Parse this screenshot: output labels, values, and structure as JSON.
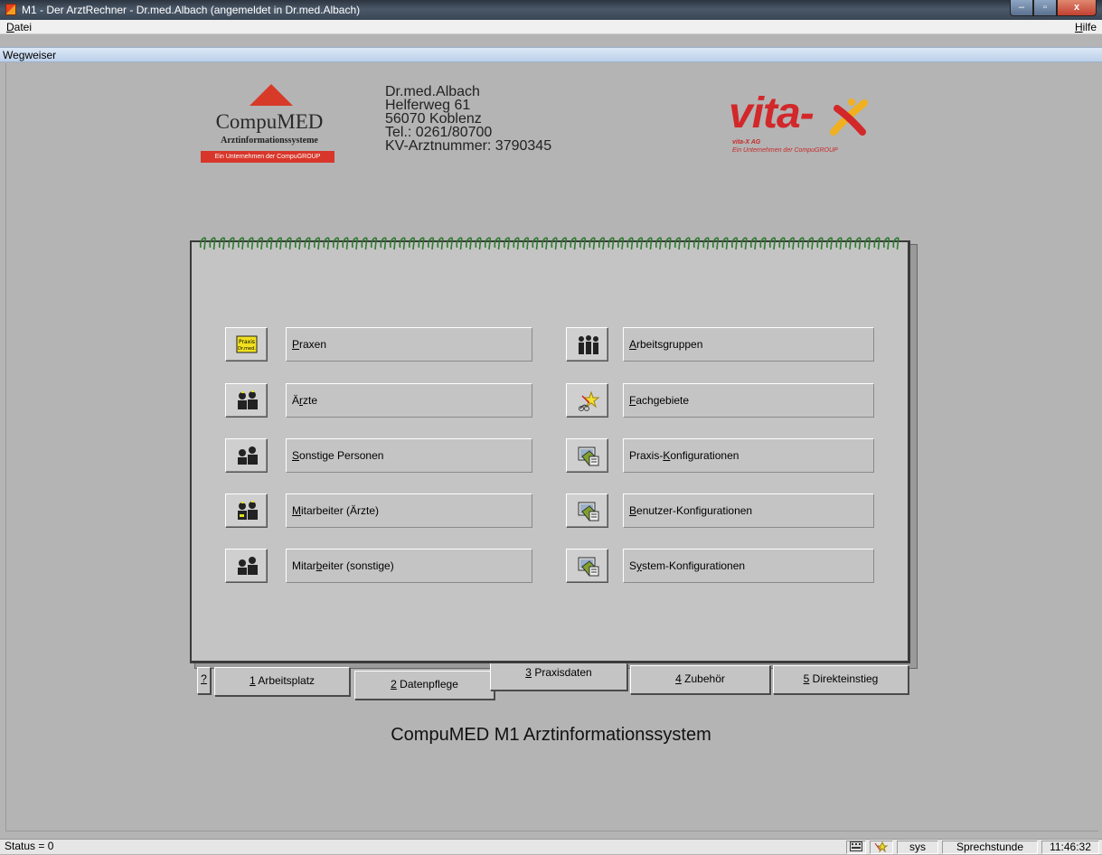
{
  "window": {
    "title": "M1 - Der ArztRechner  -  Dr.med.Albach (angemeldet in Dr.med.Albach)",
    "minimize_glyph": "–",
    "maximize_glyph": "▫",
    "close_glyph": "x"
  },
  "menu": {
    "file": "Datei",
    "help": "Hilfe"
  },
  "child_window": {
    "title": "Wegweiser"
  },
  "compumed_logo": {
    "name": "CompuMED",
    "subtitle": "Arztinformationssysteme",
    "ribbon": "Ein Unternehmen der CompuGROUP"
  },
  "address": {
    "line1": "Dr.med.Albach",
    "line2": "Helferweg 61",
    "line3": "56070 Koblenz",
    "line4": "Tel.: 0261/80700",
    "line5": "KV-Arztnummer: 3790345"
  },
  "vitax_logo": {
    "word": "vita-",
    "company": "vita-X AG",
    "tagline": "Ein Unternehmen der CompuGROUP"
  },
  "left_buttons": [
    {
      "pre": "",
      "key": "P",
      "post": "raxen",
      "icon": "praxis-icon"
    },
    {
      "pre": "Ä",
      "key": "r",
      "post": "zte",
      "icon": "doctors-icon"
    },
    {
      "pre": "",
      "key": "S",
      "post": "onstige Personen",
      "icon": "persons-icon"
    },
    {
      "pre": "",
      "key": "M",
      "post": "itarbeiter (Ärzte)",
      "icon": "doctors-icon"
    },
    {
      "pre": "Mitar",
      "key": "b",
      "post": "eiter (sonstige)",
      "icon": "persons-icon"
    }
  ],
  "praxis_icon_text": {
    "line1": "Praxis",
    "line2": "Dr.med."
  },
  "right_buttons": [
    {
      "pre": "",
      "key": "A",
      "post": "rbeitsgruppen",
      "icon": "work-groups-icon"
    },
    {
      "pre": "",
      "key": "F",
      "post": "achgebiete",
      "icon": "specialties-icon"
    },
    {
      "pre": "Praxis-",
      "key": "K",
      "post": "onfigurationen",
      "icon": "configuration-icon"
    },
    {
      "pre": "",
      "key": "B",
      "post": "enutzer-Konfigurationen",
      "icon": "configuration-icon"
    },
    {
      "pre": "S",
      "key": "y",
      "post": "stem-Konfigurationen",
      "icon": "configuration-icon"
    }
  ],
  "tabs": {
    "help": "?",
    "t1": {
      "key": "1",
      "label": " Arbeitsplatz"
    },
    "t2": {
      "key": "2",
      "label": " Datenpflege"
    },
    "t3": {
      "key": "3",
      "label": " Praxisdaten"
    },
    "t4": {
      "key": "4",
      "label": " Zubehör"
    },
    "t5": {
      "key": "5",
      "label": " Direkteinstieg"
    },
    "active": "3 Praxisdaten"
  },
  "footer_title": "CompuMED M1 Arztinformationssystem",
  "status": {
    "left": "Status = 0",
    "user": "sys",
    "mode": "Sprechstunde",
    "time": "11:46:32"
  }
}
